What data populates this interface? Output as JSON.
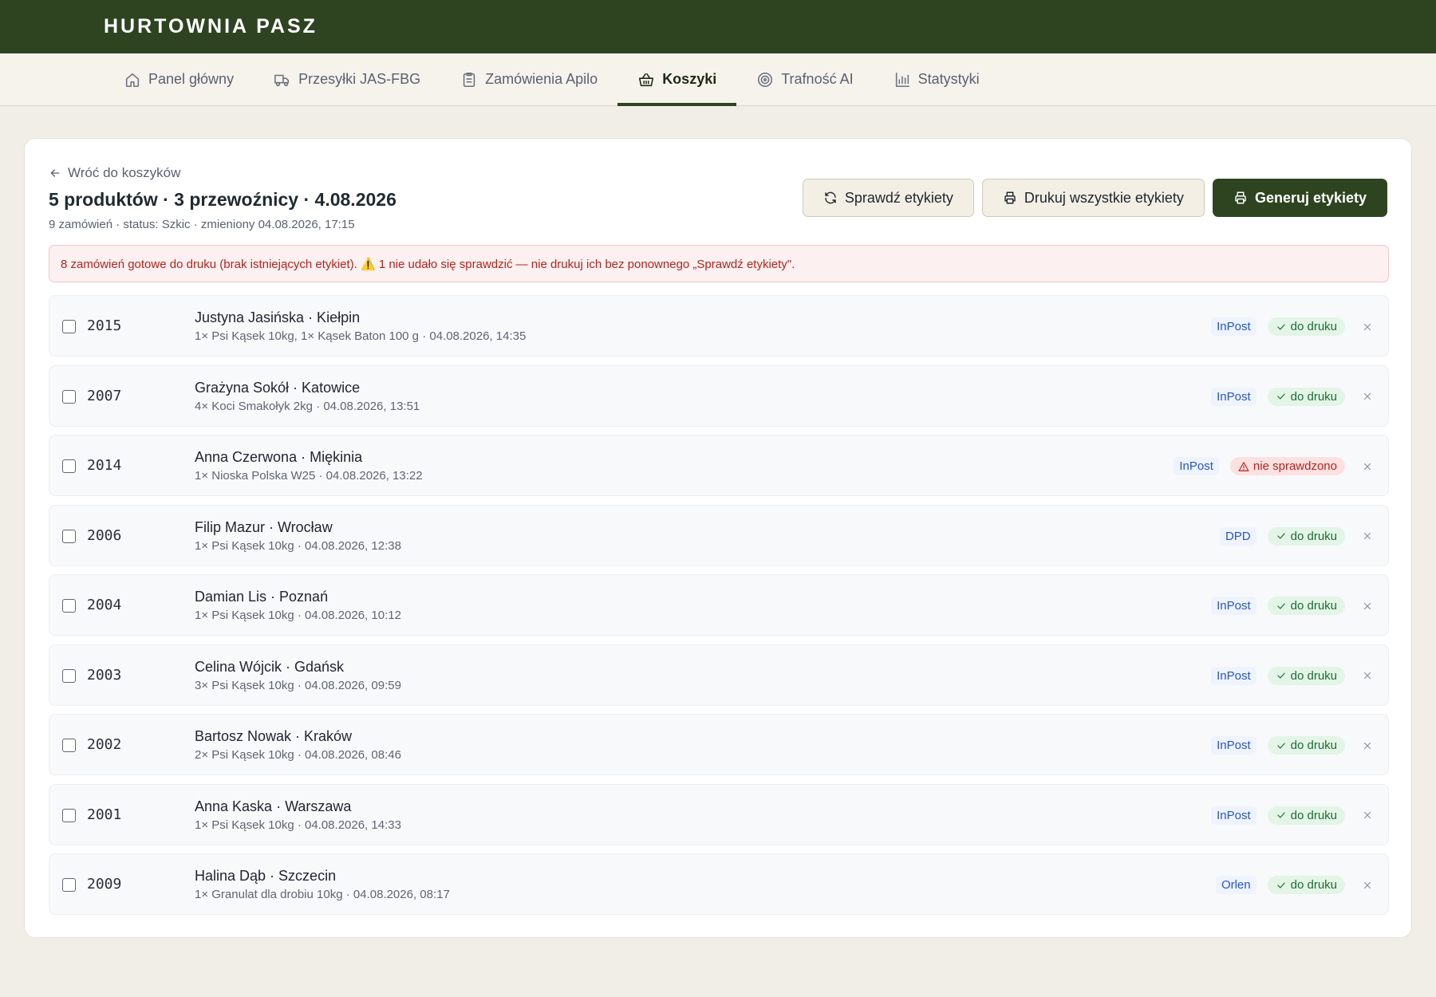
{
  "app": {
    "brand": "HURTOWNIA PASZ"
  },
  "nav": [
    {
      "label": "Panel główny",
      "icon": "home-icon",
      "active": false
    },
    {
      "label": "Przesyłki JAS-FBG",
      "icon": "truck-icon",
      "active": false
    },
    {
      "label": "Zamówienia Apilo",
      "icon": "clipboard-icon",
      "active": false
    },
    {
      "label": "Koszyki",
      "icon": "basket-icon",
      "active": true
    },
    {
      "label": "Trafność AI",
      "icon": "target-icon",
      "active": false
    },
    {
      "label": "Statystyki",
      "icon": "bar-chart-icon",
      "active": false
    }
  ],
  "header": {
    "back_label": "Wróć do koszyków",
    "title": "5 produktów · 3 przewoźnicy · 4.08.2026",
    "subtitle": "9 zamówień · status: Szkic · zmieniony 04.08.2026, 17:15"
  },
  "actions": {
    "check_label": "Sprawdź etykiety",
    "print_all_label": "Drukuj wszystkie etykiety",
    "generate_label": "Generuj etykiety"
  },
  "alert": {
    "text": "8 zamówień gotowe do druku (brak istniejących etykiet). ⚠️ 1 nie udało się sprawdzić — nie drukuj ich bez ponownego „Sprawdź etykiety\"."
  },
  "orders": [
    {
      "id": "2015",
      "customer": "Justyna Jasińska · Kiełpin",
      "items": "1× Psi Kąsek 10kg, 1× Kąsek Baton 100 g · 04.08.2026, 14:35",
      "carrier": "InPost",
      "status": "do druku",
      "status_type": "ok"
    },
    {
      "id": "2007",
      "customer": "Grażyna Sokół · Katowice",
      "items": "4× Koci Smakołyk 2kg · 04.08.2026, 13:51",
      "carrier": "InPost",
      "status": "do druku",
      "status_type": "ok"
    },
    {
      "id": "2014",
      "customer": "Anna Czerwona · Miękinia",
      "items": "1× Nioska Polska W25 · 04.08.2026, 13:22",
      "carrier": "InPost",
      "status": "nie sprawdzono",
      "status_type": "warn"
    },
    {
      "id": "2006",
      "customer": "Filip Mazur · Wrocław",
      "items": "1× Psi Kąsek 10kg · 04.08.2026, 12:38",
      "carrier": "DPD",
      "status": "do druku",
      "status_type": "ok"
    },
    {
      "id": "2004",
      "customer": "Damian Lis · Poznań",
      "items": "1× Psi Kąsek 10kg · 04.08.2026, 10:12",
      "carrier": "InPost",
      "status": "do druku",
      "status_type": "ok"
    },
    {
      "id": "2003",
      "customer": "Celina Wójcik · Gdańsk",
      "items": "3× Psi Kąsek 10kg · 04.08.2026, 09:59",
      "carrier": "InPost",
      "status": "do druku",
      "status_type": "ok"
    },
    {
      "id": "2002",
      "customer": "Bartosz Nowak · Kraków",
      "items": "2× Psi Kąsek 10kg · 04.08.2026, 08:46",
      "carrier": "InPost",
      "status": "do druku",
      "status_type": "ok"
    },
    {
      "id": "2001",
      "customer": "Anna Kaska · Warszawa",
      "items": "1× Psi Kąsek 10kg · 04.08.2026, 14:33",
      "carrier": "InPost",
      "status": "do druku",
      "status_type": "ok"
    },
    {
      "id": "2009",
      "customer": "Halina Dąb · Szczecin",
      "items": "1× Granulat dla drobiu 10kg · 04.08.2026, 08:17",
      "carrier": "Orlen",
      "status": "do druku",
      "status_type": "ok"
    }
  ]
}
